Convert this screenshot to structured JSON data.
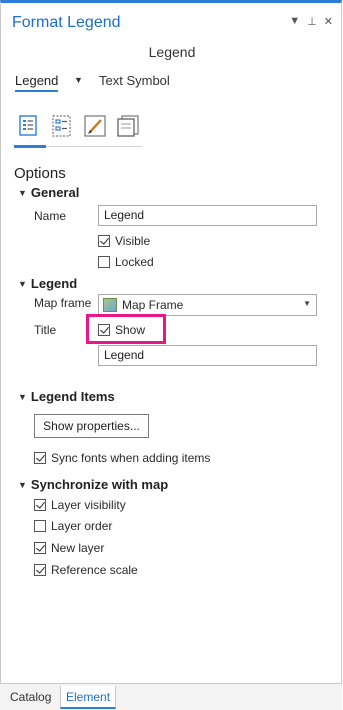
{
  "panel": {
    "title": "Format Legend",
    "controls": {
      "menu": "▼",
      "pin": "⊥",
      "close": "✕"
    },
    "subtitle": "Legend"
  },
  "tabs": {
    "dropdown_label": "Legend",
    "text_symbol": "Text Symbol"
  },
  "icons": [
    "legend-options-icon",
    "legend-arrangement-icon",
    "display-pencil-icon",
    "placement-icon"
  ],
  "options_heading": "Options",
  "general": {
    "header": "General",
    "name_label": "Name",
    "name_value": "Legend",
    "visible_label": "Visible",
    "visible_checked": true,
    "locked_label": "Locked",
    "locked_checked": false
  },
  "legend": {
    "header": "Legend",
    "map_frame_label": "Map frame",
    "map_frame_value": "Map Frame",
    "title_label": "Title",
    "show_label": "Show",
    "show_checked": true,
    "title_value": "Legend"
  },
  "legend_items": {
    "header": "Legend Items",
    "show_properties": "Show properties...",
    "sync_fonts_label": "Sync fonts when adding items",
    "sync_fonts_checked": true
  },
  "synchronize": {
    "header": "Synchronize with map",
    "layer_visibility": "Layer visibility",
    "layer_order": "Layer order",
    "new_layer": "New layer",
    "reference_scale": "Reference scale"
  },
  "bottom_tabs": {
    "catalog": "Catalog",
    "element": "Element"
  },
  "colors": {
    "accent": "#2b7fd6",
    "highlight": "#e9168a"
  }
}
